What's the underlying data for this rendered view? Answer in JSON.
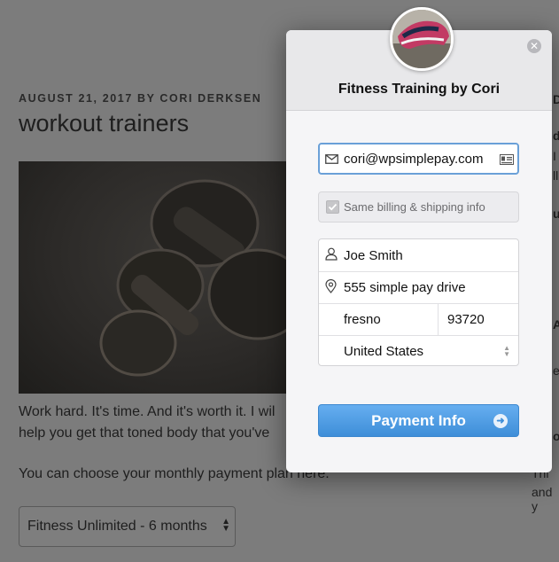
{
  "background": {
    "meta": "AUGUST 21, 2017 BY CORI DERKSEN",
    "title": "workout trainers",
    "paragraph1_line1": "Work hard. It's time. And it's worth it. I wil",
    "paragraph1_line2": "help you get that toned body that you've",
    "paragraph2": "You can choose your monthly payment plan here:",
    "select_value": "Fitness Unlimited - 6 months",
    "side_fragments": [
      "D",
      "dr",
      "I",
      "ll",
      "ur",
      "A",
      "e",
      "o",
      "Thi",
      "and y"
    ]
  },
  "modal": {
    "title": "Fitness Training by Cori",
    "close_icon": "close-icon",
    "email": "cori@wpsimplepay.com",
    "same_billing_label": "Same billing & shipping info",
    "name": "Joe Smith",
    "address": "555 simple pay drive",
    "city": "fresno",
    "zip": "93720",
    "country": "United States",
    "payment_button": "Payment Info"
  },
  "colors": {
    "accent": "#4a96df",
    "overlay": "#7c7c7c"
  }
}
